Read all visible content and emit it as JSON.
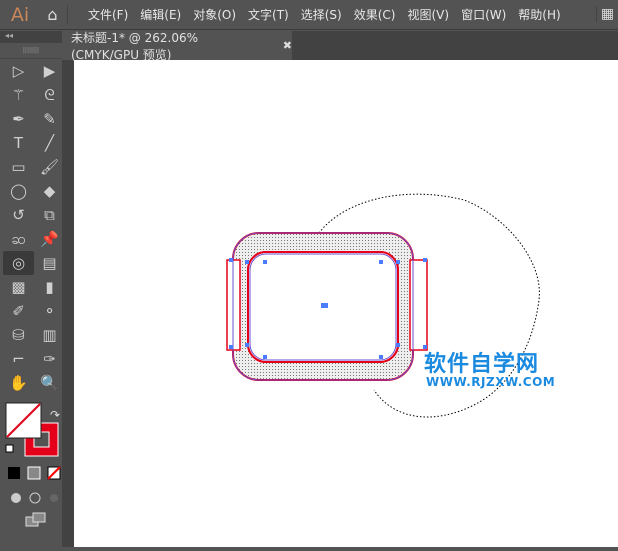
{
  "app": {
    "logo": "Ai",
    "home_icon": "⌂",
    "workspace_icon": "▦"
  },
  "menu": [
    "文件(F)",
    "编辑(E)",
    "对象(O)",
    "文字(T)",
    "选择(S)",
    "效果(C)",
    "视图(V)",
    "窗口(W)",
    "帮助(H)"
  ],
  "tab": {
    "title": "未标题-1* @ 262.06% (CMYK/GPU 预览)",
    "close": "✖"
  },
  "toolbar": {
    "collapse": "◂◂",
    "grip": "||||||||",
    "tools": [
      {
        "name": "selection-tool",
        "g": "▷"
      },
      {
        "name": "direct-selection-tool",
        "g": "▶"
      },
      {
        "name": "magic-wand-tool",
        "g": "⚚"
      },
      {
        "name": "lasso-tool",
        "g": "ᘓ"
      },
      {
        "name": "pen-tool",
        "g": "✒"
      },
      {
        "name": "curvature-tool",
        "g": "✎"
      },
      {
        "name": "type-tool",
        "g": "T"
      },
      {
        "name": "line-tool",
        "g": "╱"
      },
      {
        "name": "rectangle-tool",
        "g": "▭"
      },
      {
        "name": "paintbrush-tool",
        "g": "🖌"
      },
      {
        "name": "shaper-tool",
        "g": "◯"
      },
      {
        "name": "eraser-tool",
        "g": "◆"
      },
      {
        "name": "rotate-tool",
        "g": "↺"
      },
      {
        "name": "scale-tool",
        "g": "⧉"
      },
      {
        "name": "puppet-warp-tool",
        "g": "ဆ"
      },
      {
        "name": "pin-tool",
        "g": "📌"
      },
      {
        "name": "shape-builder-tool",
        "g": "◎"
      },
      {
        "name": "perspective-grid-tool",
        "g": "▤"
      },
      {
        "name": "mesh-tool",
        "g": "▩"
      },
      {
        "name": "gradient-tool",
        "g": "▮"
      },
      {
        "name": "eyedropper-tool",
        "g": "✐"
      },
      {
        "name": "blend-tool",
        "g": "⚬"
      },
      {
        "name": "symbol-sprayer-tool",
        "g": "⛁"
      },
      {
        "name": "column-graph-tool",
        "g": "▥"
      },
      {
        "name": "artboard-tool",
        "g": "⌐"
      },
      {
        "name": "slice-tool",
        "g": "✑"
      },
      {
        "name": "hand-tool",
        "g": "✋"
      },
      {
        "name": "zoom-tool",
        "g": "🔍"
      }
    ]
  },
  "colors": {
    "fill": "#ffffff",
    "stroke": "#e5001a",
    "selection": "#4a7cff",
    "watermark": "#1a8ae0"
  },
  "watermark": {
    "title": "软件自学网",
    "url": "WWW.RJZXW.COM"
  }
}
